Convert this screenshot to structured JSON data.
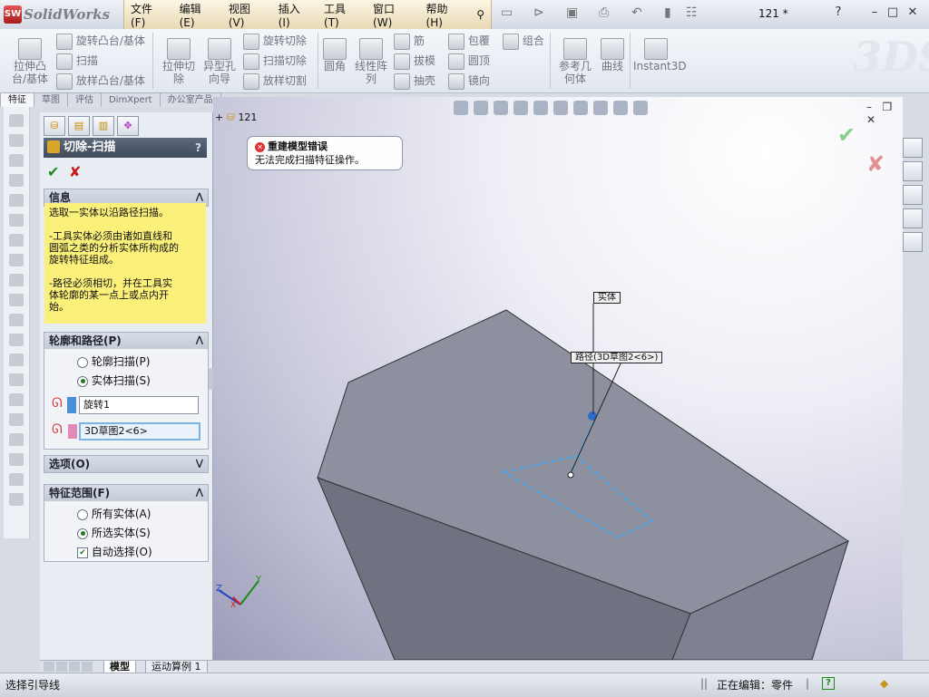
{
  "app": {
    "name": "SolidWorks",
    "logo_text": "SW",
    "doc_title": "121 *"
  },
  "menu": [
    "文件(F)",
    "编辑(E)",
    "视图(V)",
    "插入(I)",
    "工具(T)",
    "窗口(W)",
    "帮助(H)"
  ],
  "ribbon": {
    "extrude_boss": "拉伸凸台/基体",
    "revolve_boss": "旋转凸台/基体",
    "sweep": "扫描",
    "loft_boss": "放样凸台/基体",
    "extrude_cut": "拉伸切除",
    "hole_wizard": "异型孔向导",
    "revolve_cut": "旋转切除",
    "sweep_cut": "扫描切除",
    "loft_cut": "放样切割",
    "fillet": "圆角",
    "linear_pattern": "线性阵列",
    "rib": "筋",
    "draft": "拔模",
    "shell": "抽壳",
    "wrap": "包覆",
    "dome": "圆顶",
    "mirror": "镜向",
    "combine": "组合",
    "ref_geometry": "参考几何体",
    "curves": "曲线",
    "instant3d": "Instant3D"
  },
  "command_tabs": [
    "特征",
    "草图",
    "评估",
    "DimXpert",
    "办公室产品"
  ],
  "pm": {
    "title": "切除-扫描",
    "help": "?",
    "info_header": "信息",
    "info_lines": [
      "选取一实体以沿路径扫描。",
      "",
      "-工具实体必须由诸如直线和",
      "圆弧之类的分析实体所构成的",
      "旋转特征组成。",
      "",
      "-路径必须相切，并在工具实",
      "体轮廓的某一点上或点内开",
      "始。"
    ],
    "profile_header": "轮廓和路径(P)",
    "radio_profile": "轮廓扫描(P)",
    "radio_solid": "实体扫描(S)",
    "field_tool": "旋转1",
    "field_path": "3D草图2<6>",
    "options_header": "选项(O)",
    "scope_header": "特征范围(F)",
    "radio_all": "所有实体(A)",
    "radio_selected": "所选实体(S)",
    "check_auto": "自动选择(O)"
  },
  "viewport": {
    "tree_root": "121",
    "error_title": "重建模型错误",
    "error_body": "无法完成扫描特征操作。",
    "tag_solid": "实体",
    "tag_path": "路径(3D草图2<6>)",
    "triad_x": "X",
    "triad_y": "Y"
  },
  "bottom_tabs": [
    "模型",
    "运动算例 1"
  ],
  "status": {
    "left": "选择引导线",
    "editing": "正在编辑：零件",
    "help": "?"
  },
  "colors": {
    "tool_swatch": "#4a90d9",
    "path_swatch": "#e58ab8",
    "info_bg": "#fbf07a",
    "part_face": "#7d8191"
  }
}
